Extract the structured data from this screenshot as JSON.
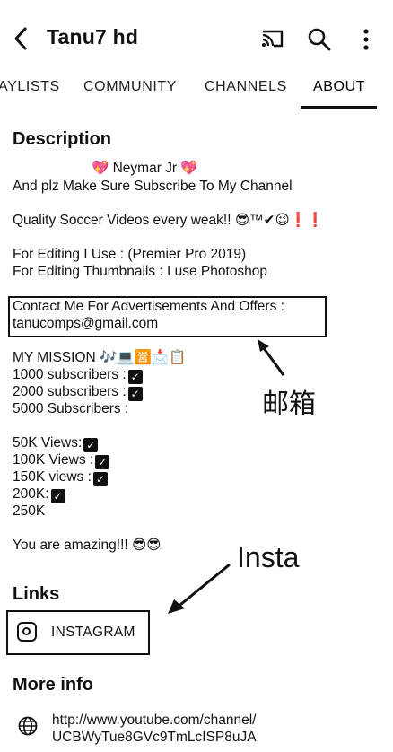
{
  "header": {
    "back_icon": "arrow-back-icon",
    "title": "Tanu7 hd",
    "cast_icon": "cast-icon",
    "search_icon": "search-icon",
    "more_icon": "more-vert-icon"
  },
  "tabs": [
    {
      "label": "AYLISTS"
    },
    {
      "label": "COMMUNITY"
    },
    {
      "label": "CHANNELS"
    },
    {
      "label": "ABOUT",
      "active": true
    }
  ],
  "description": {
    "heading": "Description",
    "lines": [
      "💖 Neymar Jr 💖",
      "And plz Make Sure Subscribe To My Channel",
      "Quality Soccer Videos every weak!! 😎™✔😉❗❗",
      "For Editing I Use : (Premier Pro 2019)",
      "For Editing Thumbnails : I use Photoshop",
      "Contact Me For Advertisements And Offers :",
      "tanucomps@gmail.com",
      "MY MISSION 🎶💻🈺📩📋",
      "1000 subscribers :",
      "2000 subscribers :",
      "5000 Subscribers :",
      "50K Views:",
      "100K Views :",
      "150K views :",
      "200K:",
      "250K",
      "You are amazing!!! 😎😎"
    ]
  },
  "annotations": {
    "email_label": "邮箱",
    "insta_label": "Insta"
  },
  "links": {
    "heading": "Links",
    "items": [
      {
        "label": "INSTAGRAM",
        "icon": "instagram-icon"
      }
    ]
  },
  "more_info": {
    "heading": "More info",
    "url_line1": "http://www.youtube.com/channel/",
    "url_line2": "UCBWyTue8GVc9TmLcISP8uJA",
    "icon": "globe-icon"
  }
}
